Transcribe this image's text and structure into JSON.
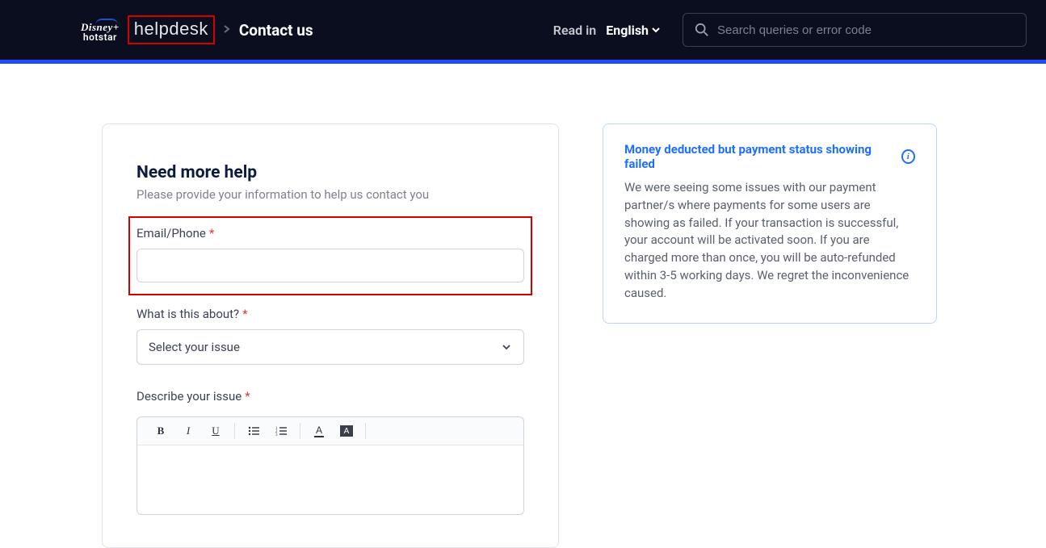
{
  "header": {
    "logo_line1": "Disney+",
    "logo_line2": "hotstar",
    "helpdesk": "helpdesk",
    "breadcrumb_current": "Contact us",
    "readin_label": "Read in",
    "language": "English",
    "search_placeholder": "Search queries or error code"
  },
  "form": {
    "title": "Need more help",
    "subtitle": "Please provide your information to help us contact you",
    "email_label": "Email/Phone",
    "email_value": "",
    "about_label": "What is this about?",
    "about_placeholder": "Select your issue",
    "describe_label": "Describe your issue"
  },
  "sidebar": {
    "title": "Money deducted but payment status showing failed",
    "body": "We were seeing some issues with our payment partner/s where payments for some users are showing as failed. If your transaction is successful, your account will be activated soon. If you are charged more than once, you will be auto-refunded within 3-5 working days. We regret the inconvenience caused."
  }
}
